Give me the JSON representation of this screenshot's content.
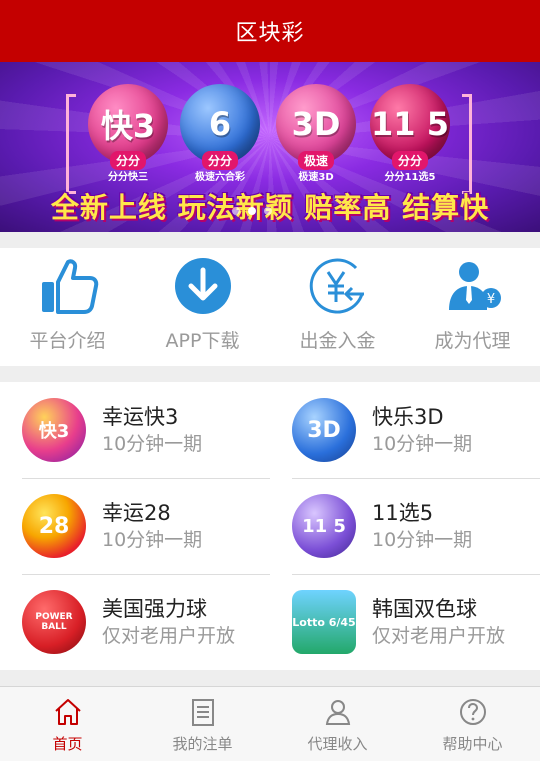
{
  "header": {
    "title": "区块彩"
  },
  "banner": {
    "balls": [
      {
        "big": "快3",
        "tag": "分分",
        "caption": "分分快三",
        "color": "#e03a8a"
      },
      {
        "big": "6",
        "tag": "分分",
        "caption": "极速六合彩",
        "color": "#2f6fd8"
      },
      {
        "big": "3D",
        "tag": "极速",
        "caption": "极速3D",
        "color": "#e0449a"
      },
      {
        "big": "11 5",
        "tag": "分分",
        "caption": "分分11选5",
        "color": "#c4135f"
      }
    ],
    "slogan": "全新上线 玩法新颖 赔率高 结算快",
    "active_slide": 2,
    "slide_count": 3
  },
  "quick_menu": [
    {
      "label": "平台介绍",
      "icon": "thumbs-up-icon"
    },
    {
      "label": "APP下载",
      "icon": "download-icon"
    },
    {
      "label": "出金入金",
      "icon": "yuan-exchange-icon"
    },
    {
      "label": "成为代理",
      "icon": "agent-person-icon"
    }
  ],
  "games": [
    {
      "name": "幸运快3",
      "sub": "10分钟一期",
      "icon": "lucky-k3-icon",
      "badge": "快3",
      "color": "#e83e8c"
    },
    {
      "name": "快乐3D",
      "sub": "10分钟一期",
      "icon": "happy-3d-icon",
      "badge": "3D",
      "color": "#2a6fdb"
    },
    {
      "name": "幸运28",
      "sub": "10分钟一期",
      "icon": "lucky-28-icon",
      "badge": "28",
      "color": "#e8202a"
    },
    {
      "name": "11选5",
      "sub": "10分钟一期",
      "icon": "eleven-choose-five-icon",
      "badge": "11 5",
      "color": "#7b4fd6"
    },
    {
      "name": "美国强力球",
      "sub": "仅对老用户开放",
      "icon": "us-powerball-icon",
      "badge": "POWER BALL",
      "color": "#d81f26"
    },
    {
      "name": "韩国双色球",
      "sub": "仅对老用户开放",
      "icon": "korea-lotto-icon",
      "badge": "Lotto 6/45",
      "color": "#23a86a"
    }
  ],
  "tabbar": [
    {
      "label": "首页",
      "icon": "home-icon",
      "active": true
    },
    {
      "label": "我的注单",
      "icon": "order-list-icon",
      "active": false
    },
    {
      "label": "代理收入",
      "icon": "agent-income-icon",
      "active": false
    },
    {
      "label": "帮助中心",
      "icon": "help-icon",
      "active": false
    }
  ],
  "colors": {
    "brand": "#c40000",
    "muted_text": "#9a9a9a",
    "accent_blue": "#2a8fd8"
  }
}
